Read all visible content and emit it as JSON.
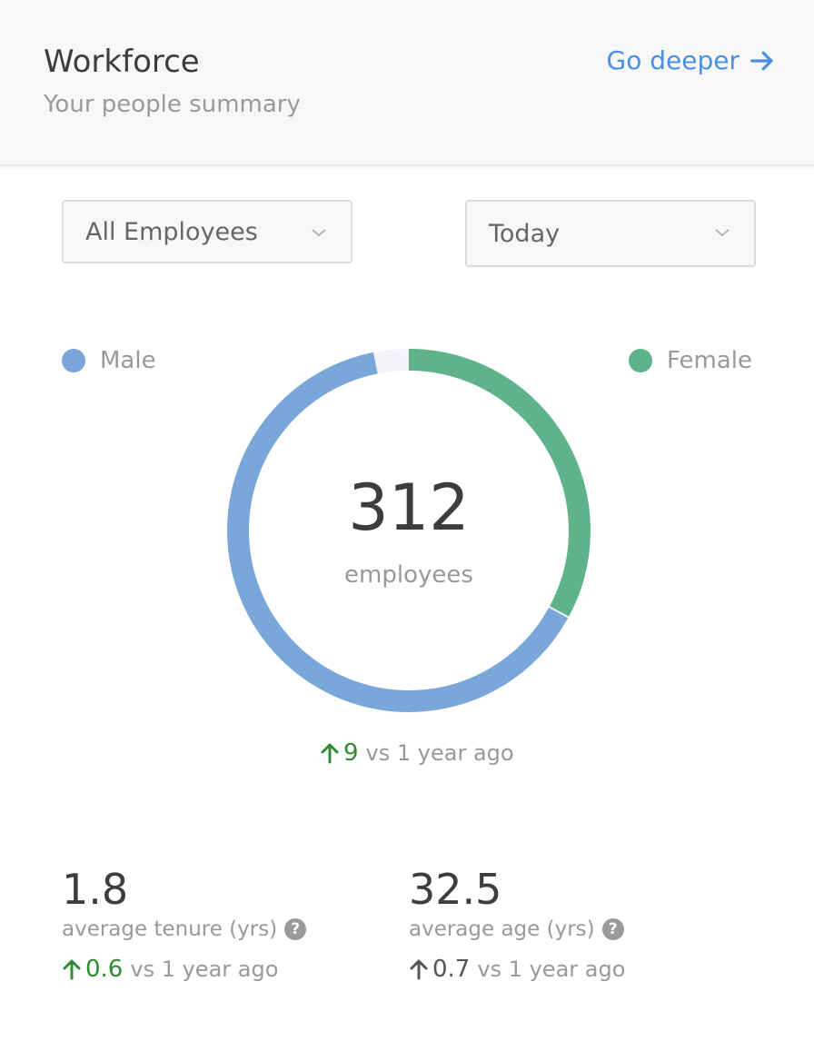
{
  "header": {
    "title": "Workforce",
    "subtitle": "Your people summary",
    "link_label": "Go deeper",
    "link_icon": "arrow-right-icon"
  },
  "filters": {
    "employees_selected": "All Employees",
    "date_selected": "Today"
  },
  "chart_data": {
    "type": "pie",
    "style": "donut",
    "categories": [
      "Male",
      "Female"
    ],
    "values": [
      0.64,
      0.33
    ],
    "unassigned_fraction": 0.03,
    "colors": {
      "Male": "#7aa7da",
      "Female": "#5fb38b",
      "gap": "#f2f4f7"
    },
    "legend_placement": "top-left / top-right",
    "center_value": "312",
    "center_label": "employees"
  },
  "summary": {
    "delta_value": "9",
    "delta_text": "vs 1 year ago"
  },
  "stats": {
    "tenure": {
      "value": "1.8",
      "label": "average tenure (yrs)",
      "delta_value": "0.6",
      "delta_text": "vs 1 year ago"
    },
    "age": {
      "value": "32.5",
      "label": "average age (yrs)",
      "delta_value": "0.7",
      "delta_text": "vs 1 year ago"
    }
  },
  "colors": {
    "accent": "#4a90e2",
    "positive": "#2e8b2e",
    "neutral_arrow": "#555555"
  }
}
